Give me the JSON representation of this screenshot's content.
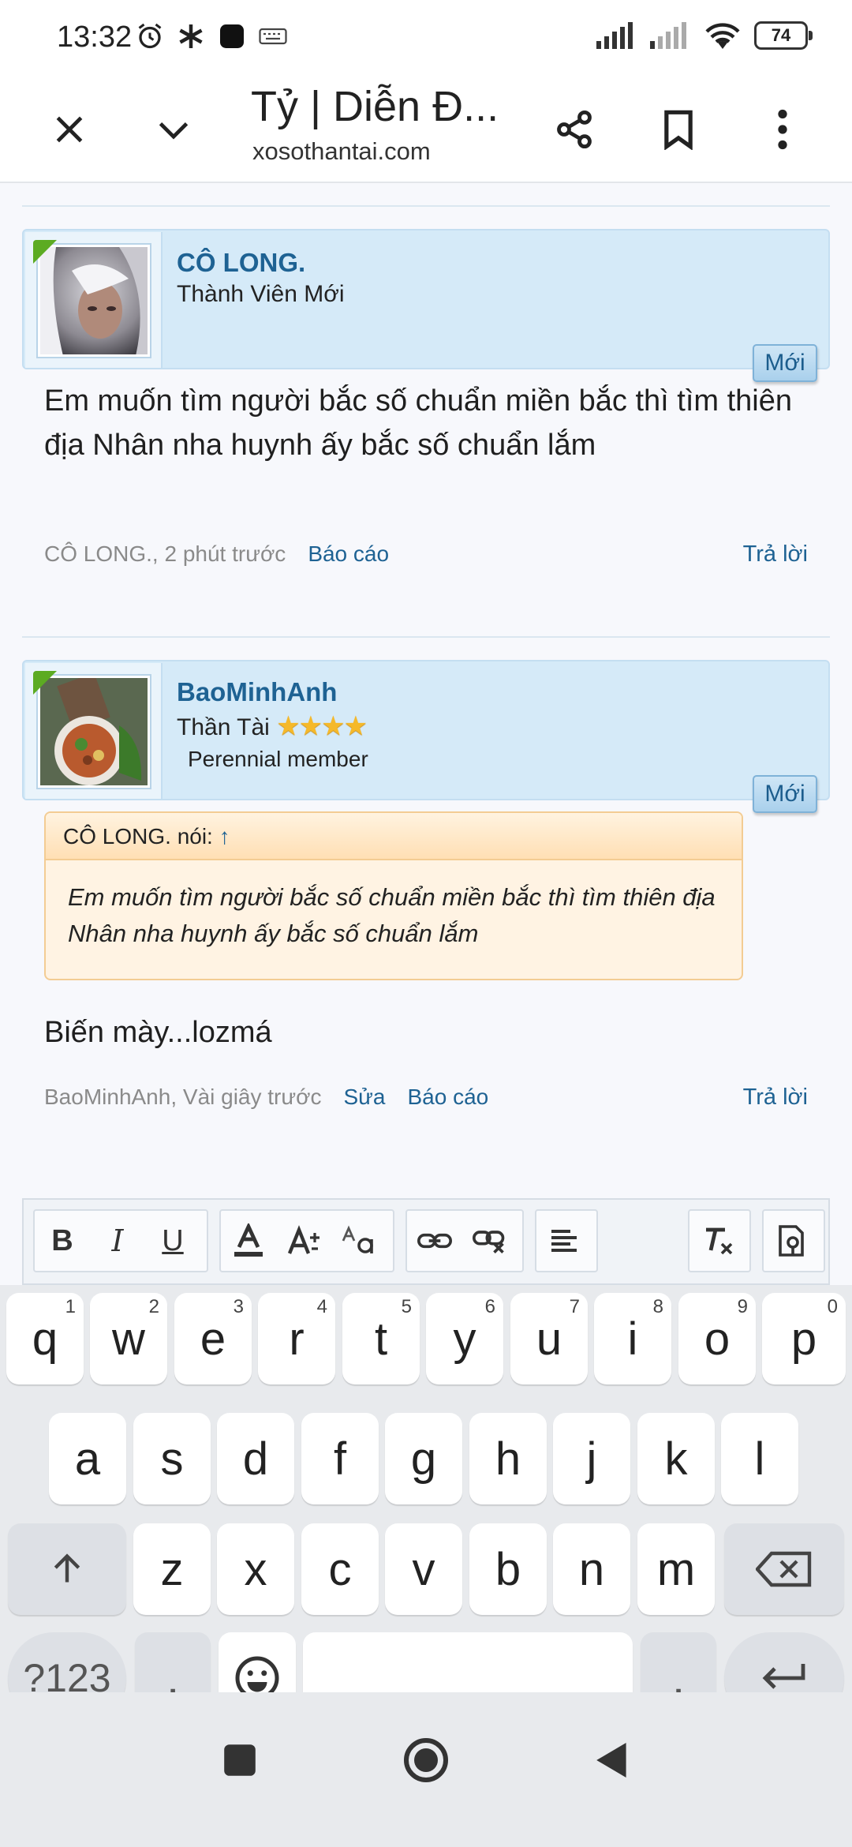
{
  "status_bar": {
    "time": "13:32",
    "battery": "74"
  },
  "browser": {
    "title": "Tỷ | Diễn Đ...",
    "url": "xosothantai.com"
  },
  "posts": [
    {
      "username": "CÔ LONG.",
      "user_title": "Thành Viên Mới",
      "badge": "Mới",
      "message": "Em muốn tìm người bắc số chuẩn miền bắc thì tìm thiên địa Nhân nha huynh ấy bắc số chuẩn lắm",
      "meta_author": "CÔ LONG., 2 phút trước",
      "report": "Báo cáo",
      "reply": "Trả lời"
    },
    {
      "username": "BaoMinhAnh",
      "user_title": "Thần Tài",
      "stars": "★★★★",
      "member_note": "Perennial member",
      "badge": "Mới",
      "quote_header": "CÔ LONG. nói:",
      "quote_arrow": "↑",
      "quote_text": "Em muốn tìm người bắc số chuẩn miền bắc thì tìm thiên địa Nhân nha huynh ấy bắc số chuẩn lắm",
      "message": "Biến mày...lozmá",
      "meta_author": "BaoMinhAnh, Vài giây trước",
      "edit": "Sửa",
      "report": "Báo cáo",
      "reply": "Trả lời"
    }
  ],
  "editor": {
    "bold": "B",
    "italic": "I",
    "underline": "U"
  },
  "keyboard": {
    "row1": [
      {
        "key": "q",
        "hint": "1"
      },
      {
        "key": "w",
        "hint": "2"
      },
      {
        "key": "e",
        "hint": "3"
      },
      {
        "key": "r",
        "hint": "4"
      },
      {
        "key": "t",
        "hint": "5"
      },
      {
        "key": "y",
        "hint": "6"
      },
      {
        "key": "u",
        "hint": "7"
      },
      {
        "key": "i",
        "hint": "8"
      },
      {
        "key": "o",
        "hint": "9"
      },
      {
        "key": "p",
        "hint": "0"
      }
    ],
    "row2": [
      "a",
      "s",
      "d",
      "f",
      "g",
      "h",
      "j",
      "k",
      "l"
    ],
    "row3": [
      "z",
      "x",
      "c",
      "v",
      "b",
      "n",
      "m"
    ],
    "symbols": "?123",
    "comma": ",",
    "period": "."
  }
}
